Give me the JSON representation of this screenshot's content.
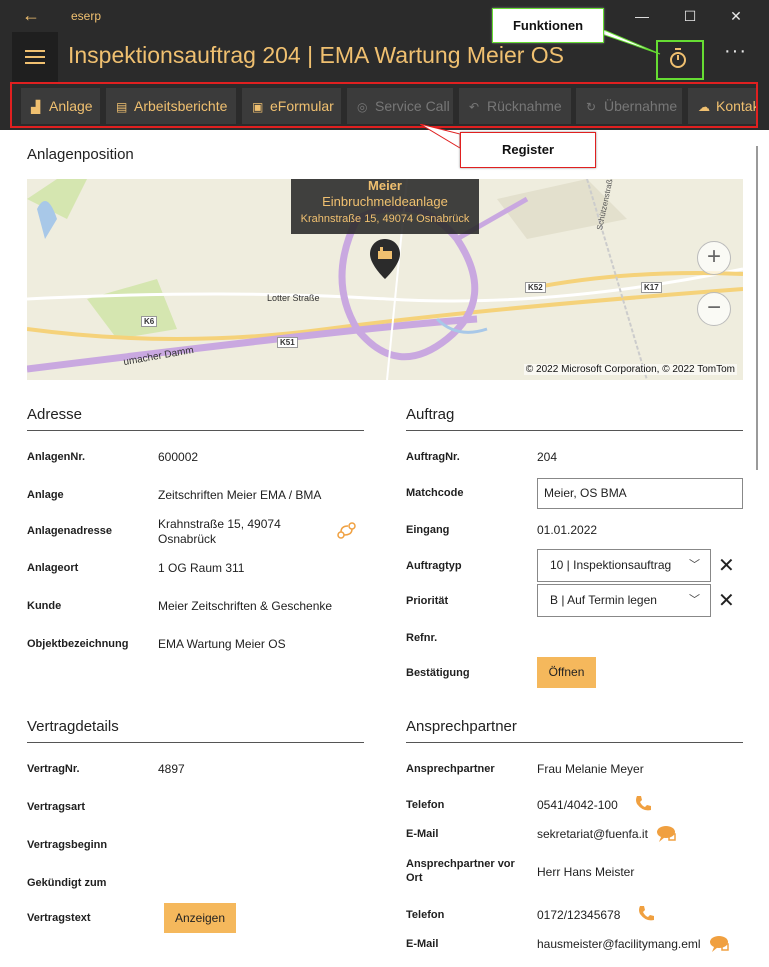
{
  "window": {
    "app_name": "eserp",
    "back": "←",
    "minimize": "—",
    "maximize": "☐",
    "close": "✕"
  },
  "header": {
    "title": "Inspektionsauftrag 204  |  EMA Wartung Meier OS",
    "more": "···"
  },
  "callouts": {
    "functions": "Funktionen",
    "register": "Register"
  },
  "tabs": [
    {
      "label": "Anlage",
      "icon": "factory-icon",
      "enabled": true
    },
    {
      "label": "Arbeitsberichte",
      "icon": "clipboard-icon",
      "enabled": true
    },
    {
      "label": "eFormular",
      "icon": "clipboard-check-icon",
      "enabled": true
    },
    {
      "label": "Service Call",
      "icon": "globe-icon",
      "enabled": false
    },
    {
      "label": "Rücknahme",
      "icon": "undo-icon",
      "enabled": false
    },
    {
      "label": "Übernahme",
      "icon": "refresh-icon",
      "enabled": false
    },
    {
      "label": "Kontakt",
      "icon": "chat-icon",
      "enabled": true
    }
  ],
  "map_section": {
    "title": "Anlagenposition",
    "pin": {
      "name": "Meier",
      "type": "Einbruchmeldeanlage",
      "address": "Krahnstraße 15, 49074 Osnabrück"
    },
    "streets": [
      "Lotter Straße",
      "K6",
      "K51",
      "K52",
      "K17",
      "Schützenstraße",
      "umacher Damm"
    ],
    "zoom_in": "+",
    "zoom_out": "−",
    "copyright": "© 2022 Microsoft Corporation, © 2022 TomTom"
  },
  "adresse": {
    "title": "Adresse",
    "fields": [
      {
        "label": "AnlagenNr.",
        "value": "600002"
      },
      {
        "label": "Anlage",
        "value": "Zeitschriften Meier EMA / BMA"
      },
      {
        "label": "Anlagenadresse",
        "value_line1": "Krahnstraße 15, 49074",
        "value_line2": "Osnabrück"
      },
      {
        "label": "Anlageort",
        "value": "1 OG Raum 311"
      },
      {
        "label": "Kunde",
        "value": "Meier Zeitschriften & Geschenke"
      },
      {
        "label": "Objektbezeichnung",
        "value": "EMA Wartung Meier OS"
      }
    ]
  },
  "auftrag": {
    "title": "Auftrag",
    "auftragnr_label": "AuftragNr.",
    "auftragnr": "204",
    "matchcode_label": "Matchcode",
    "matchcode": "Meier, OS BMA",
    "eingang_label": "Eingang",
    "eingang": "01.01.2022",
    "auftragtyp_label": "Auftragtyp",
    "auftragtyp": "10  |  Inspektionsauftrag",
    "prioritaet_label": "Priorität",
    "prioritaet": "B  |  Auf Termin legen",
    "refnr_label": "Refnr.",
    "bestaetigung_label": "Bestätigung",
    "open_button": "Öffnen",
    "clear": "✕",
    "chevron": "﹀"
  },
  "vertrag": {
    "title": "Vertragdetails",
    "vertragnr_label": "VertragNr.",
    "vertragnr": "4897",
    "vertragsart_label": "Vertragsart",
    "vertragsbeginn_label": "Vertragsbeginn",
    "gekuendigt_label": "Gekündigt zum",
    "vertragstext_label": "Vertragstext",
    "show_button": "Anzeigen"
  },
  "ansprechpartner": {
    "title": "Ansprechpartner",
    "ap_label": "Ansprechpartner",
    "ap_value": "Frau Melanie Meyer",
    "tel_label": "Telefon",
    "tel_value": "0541/4042-100",
    "mail_label": "E-Mail",
    "mail_value": "sekretariat@fuenfa.it",
    "ap_ort_label_line1": "Ansprechpartner vor",
    "ap_ort_label_line2": "Ort",
    "ap_ort_value": "Herr Hans Meister",
    "tel2_label": "Telefon",
    "tel2_value": "0172/12345678",
    "mail2_label": "E-Mail",
    "mail2_value": "hausmeister@facilitymang.eml"
  },
  "colors": {
    "accent": "#f0c070",
    "button": "#f5b85c",
    "dark": "#2b2b2b",
    "highlight_green": "#66dd33",
    "highlight_red": "#e02020"
  }
}
